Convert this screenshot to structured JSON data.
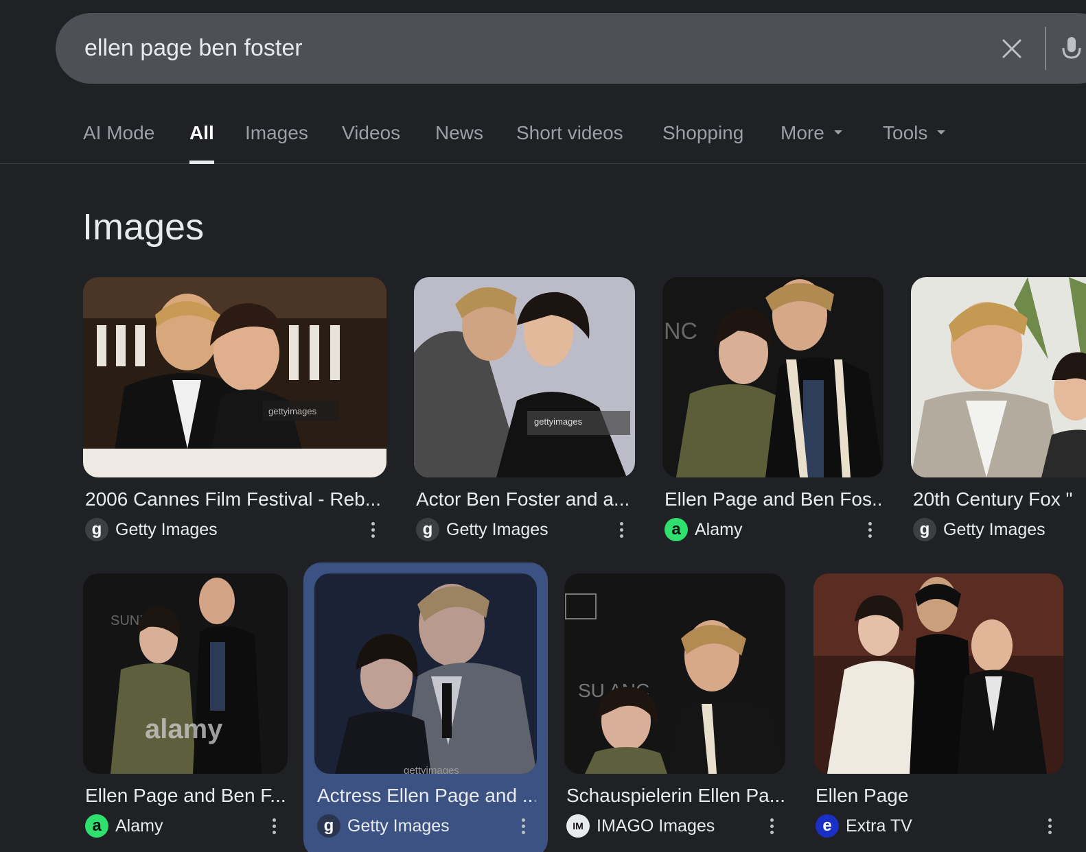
{
  "search": {
    "query": "ellen page ben foster"
  },
  "icons": {
    "clear": "close-icon",
    "mic": "mic-icon",
    "caret": "caret-down-icon"
  },
  "tabs": [
    {
      "label": "AI Mode"
    },
    {
      "label": "All"
    },
    {
      "label": "Images"
    },
    {
      "label": "Videos"
    },
    {
      "label": "News"
    },
    {
      "label": "Short videos"
    },
    {
      "label": "Shopping"
    },
    {
      "label": "More"
    },
    {
      "label": "Tools"
    }
  ],
  "active_tab": "All",
  "section": {
    "title": "Images"
  },
  "images": [
    {
      "title": "2006 Cannes Film Festival - Reb...",
      "source": "Getty Images",
      "source_icon": "g"
    },
    {
      "title": "Actor Ben Foster and a...",
      "source": "Getty Images",
      "source_icon": "g"
    },
    {
      "title": "Ellen Page and Ben Fos...",
      "source": "Alamy",
      "source_icon": "a"
    },
    {
      "title": "20th Century Fox \"",
      "source": "Getty Images",
      "source_icon": "g"
    },
    {
      "title": "Ellen Page and Ben F...",
      "source": "Alamy",
      "source_icon": "a"
    },
    {
      "title": "Actress Ellen Page and ...",
      "source": "Getty Images",
      "source_icon": "g"
    },
    {
      "title": "Schauspielerin Ellen Pa...",
      "source": "IMAGO Images",
      "source_icon": "IM"
    },
    {
      "title": "Ellen Page",
      "source": "Extra TV",
      "source_icon": "e"
    }
  ],
  "watermarks": {
    "getty": "gettyimages",
    "alamy": "alamy"
  },
  "colors": {
    "background": "#202124",
    "searchbar": "#4d5156",
    "selected": "#3b5282",
    "alamy": "#2fe06f",
    "extra": "#1a2fc4"
  }
}
